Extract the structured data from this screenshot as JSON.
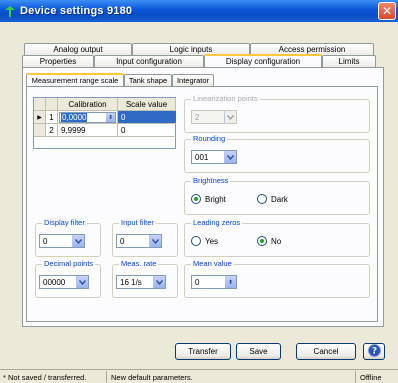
{
  "window": {
    "title": "Device settings 9180"
  },
  "tabs_back": [
    {
      "label": "Analog output"
    },
    {
      "label": "Logic inputs"
    },
    {
      "label": "Access permission"
    }
  ],
  "tabs_front": [
    {
      "label": "Properties"
    },
    {
      "label": "Input configuration"
    },
    {
      "label": "Display configuration"
    },
    {
      "label": "Limits"
    }
  ],
  "inner_tabs": [
    {
      "label": "Measurement range scale"
    },
    {
      "label": "Tank shape"
    },
    {
      "label": "Integrator"
    }
  ],
  "scale_table": {
    "headers": [
      "Calibration",
      "Scale value"
    ],
    "rows": [
      {
        "num": "1",
        "calibration": "0,0000",
        "scale": "0"
      },
      {
        "num": "2",
        "calibration": "9,9999",
        "scale": "0"
      }
    ]
  },
  "linearization": {
    "label": "Linearization points",
    "value": "2"
  },
  "rounding": {
    "label": "Rounding",
    "value": "001"
  },
  "brightness": {
    "label": "Brightness",
    "options": [
      "Bright",
      "Dark"
    ],
    "selected": "Bright"
  },
  "leading_zeros": {
    "label": "Leading zeros",
    "options": [
      "Yes",
      "No"
    ],
    "selected": "No"
  },
  "mean_value": {
    "label": "Mean value",
    "value": "0"
  },
  "display_filter": {
    "label": "Display filter",
    "value": "0"
  },
  "input_filter": {
    "label": "Input filter",
    "value": "0"
  },
  "decimal_points": {
    "label": "Decimal points",
    "value": "00000"
  },
  "meas_rate": {
    "label": "Meas. rate",
    "value": "16 1/s"
  },
  "buttons": {
    "transfer": "Transfer",
    "save": "Save",
    "cancel": "Cancel"
  },
  "status": {
    "saved": "* Not saved / transferred.",
    "message": "New default parameters.",
    "connection": "Offline"
  },
  "colors": {
    "accent": "#0046d5",
    "title_bar": "#0a54d8",
    "tab_highlight": "#ffc83c"
  }
}
